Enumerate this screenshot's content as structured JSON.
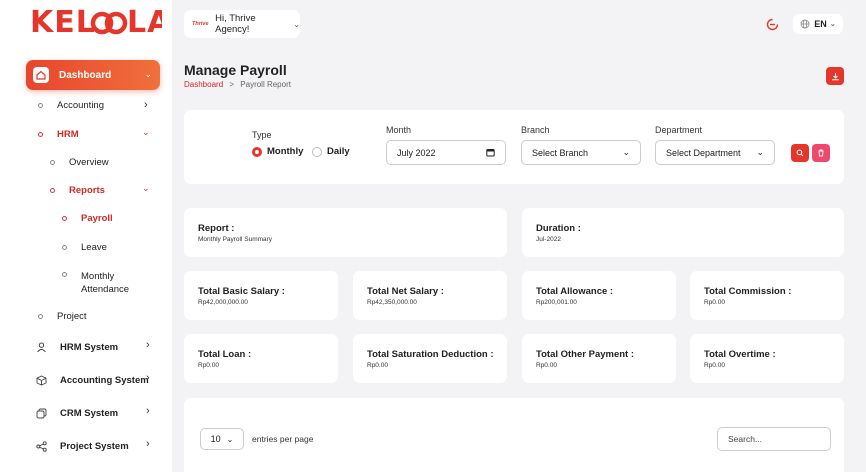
{
  "brand": {
    "logo": "KELOOLA"
  },
  "sidebar": {
    "dashboard": "Dashboard",
    "accounting": "Accounting",
    "hrm": "HRM",
    "overview": "Overview",
    "reports": "Reports",
    "payroll": "Payroll",
    "leave": "Leave",
    "monthly_attendance_1": "Monthly",
    "monthly_attendance_2": "Attendance",
    "project": "Project",
    "systems": [
      {
        "label": "HRM System",
        "icon": "person-icon"
      },
      {
        "label": "Accounting System",
        "icon": "box-icon"
      },
      {
        "label": "CRM System",
        "icon": "layers-icon"
      },
      {
        "label": "Project System",
        "icon": "share-icon"
      }
    ]
  },
  "topbar": {
    "thrive_logo": "Thrive",
    "greeting": "Hi, Thrive Agency!",
    "language": "EN"
  },
  "header": {
    "title": "Manage Payroll",
    "crumb_home": "Dashboard",
    "crumb_sep": ">",
    "crumb_current": "Payroll Report"
  },
  "filters": {
    "type_label": "Type",
    "monthly": "Monthly",
    "daily": "Daily",
    "selected_type": "Monthly",
    "month_label": "Month",
    "month_value": "July 2022",
    "branch_label": "Branch",
    "branch_value": "Select Branch",
    "department_label": "Department",
    "department_value": "Select Department"
  },
  "report": {
    "report_title": "Report :",
    "report_value": "Monthly Payroll Summary",
    "duration_title": "Duration :",
    "duration_value": "Jul-2022"
  },
  "stats": [
    {
      "title": "Total Basic Salary :",
      "value": "Rp42,000,000.00"
    },
    {
      "title": "Total Net Salary :",
      "value": "Rp42,350,000.00"
    },
    {
      "title": "Total Allowance :",
      "value": "Rp200,001.00"
    },
    {
      "title": "Total Commission :",
      "value": "Rp0.00"
    },
    {
      "title": "Total Loan :",
      "value": "Rp0.00"
    },
    {
      "title": "Total Saturation Deduction :",
      "value": "Rp0.00"
    },
    {
      "title": "Total Other Payment :",
      "value": "Rp0.00"
    },
    {
      "title": "Total Overtime :",
      "value": "Rp0.00"
    }
  ],
  "table": {
    "entries_value": "10",
    "entries_label": "entries per page",
    "search_placeholder": "Search..."
  },
  "colors": {
    "accent": "#e5362c",
    "pink": "#f0476c"
  }
}
